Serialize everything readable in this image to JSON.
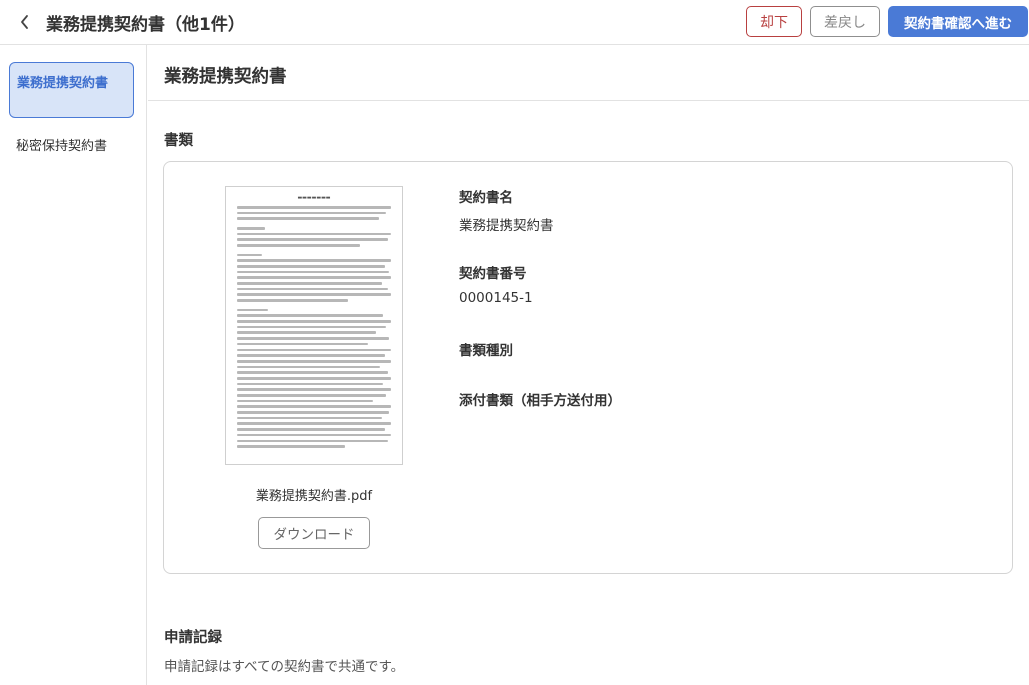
{
  "header": {
    "title": "業務提携契約書（他1件）",
    "reject_label": "却下",
    "return_label": "差戻し",
    "next_label": "契約書確認へ進む"
  },
  "sidebar": {
    "items": [
      {
        "label": "業務提携契約書",
        "active": true
      },
      {
        "label": "秘密保持契約書",
        "active": false
      }
    ]
  },
  "main": {
    "title": "業務提携契約書",
    "documents_heading": "書類",
    "document": {
      "file_name": "業務提携契約書.pdf",
      "download_label": "ダウンロード",
      "fields": [
        {
          "label": "契約書名",
          "value": "業務提携契約書"
        },
        {
          "label": "契約書番号",
          "value": "0000145-1"
        },
        {
          "label": "書類種別",
          "value": ""
        },
        {
          "label": "添付書類（相手方送付用）",
          "value": ""
        }
      ]
    },
    "records_heading": "申請記録",
    "records_note": "申請記録はすべての契約書で共通です。"
  },
  "colors": {
    "primary": "#4a7ad6",
    "reject": "#b84040",
    "active_bg": "#d8e4f8",
    "border": "#d4d4d4"
  },
  "icons": {
    "back": "chevron-left-icon",
    "document_preview": "document-thumbnail"
  }
}
